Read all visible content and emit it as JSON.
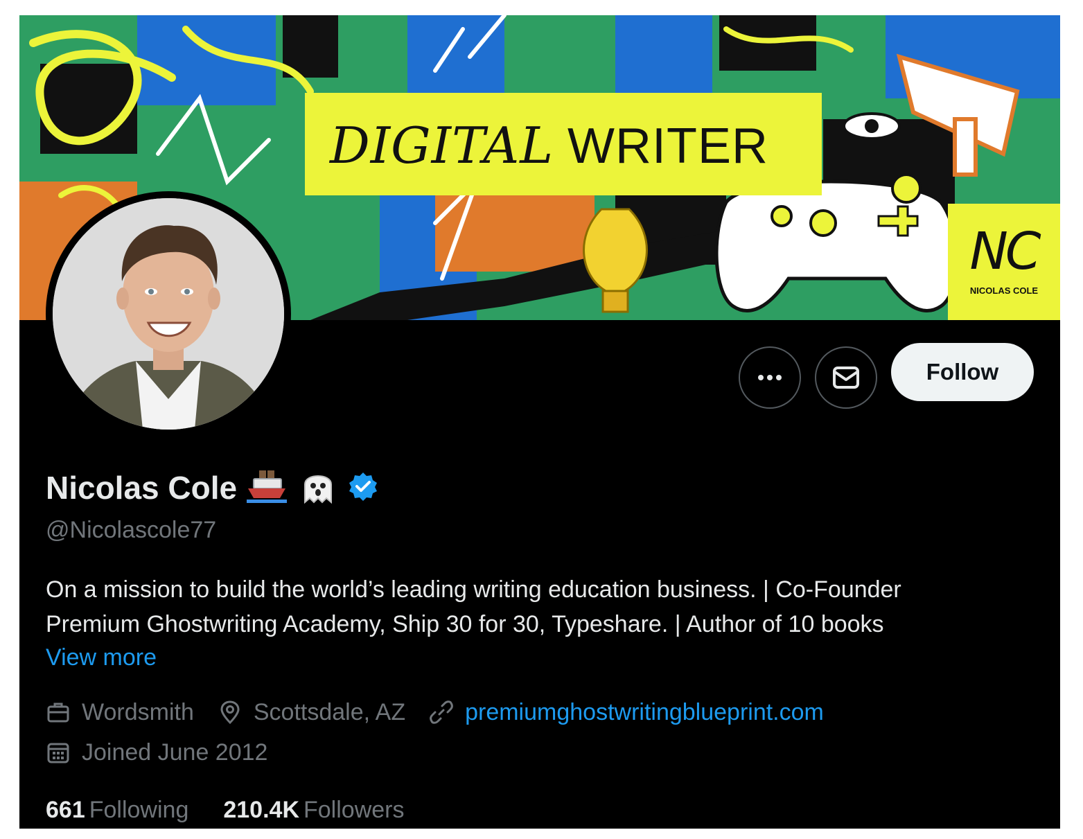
{
  "banner": {
    "headline_word1": "DIGITAL",
    "headline_word2": "WRITER",
    "monogram": "NC",
    "monogram_name": "NICOLAS COLE"
  },
  "actions": {
    "more_icon": "more-horizontal-icon",
    "message_icon": "envelope-icon",
    "follow_label": "Follow"
  },
  "profile": {
    "name": "Nicolas Cole",
    "name_emojis": [
      "ship-icon",
      "ghost-icon"
    ],
    "verified_icon": "verified-badge-icon",
    "handle": "@Nicolascole77",
    "bio_line1": "On a mission to build the world’s leading writing education business. | Co-Founder",
    "bio_line2": "Premium Ghostwriting Academy, Ship 30 for 30, Typeshare. | Author of 10 books",
    "view_more": "View more"
  },
  "meta": {
    "profession": "Wordsmith",
    "location": "Scottsdale, AZ",
    "website": "premiumghostwritingblueprint.com",
    "joined": "Joined June 2012"
  },
  "stats": {
    "following_count": "661",
    "following_label": "Following",
    "followers_count": "210.4K",
    "followers_label": "Followers"
  },
  "colors": {
    "background": "#000000",
    "accent_blue": "#1d9bf0",
    "secondary_text": "#71767b",
    "primary_text": "#e7e9ea",
    "banner_yellow": "#ecf43a",
    "banner_green": "#2e9e62",
    "banner_blue": "#1f6fd1",
    "banner_orange": "#e07a2c"
  }
}
